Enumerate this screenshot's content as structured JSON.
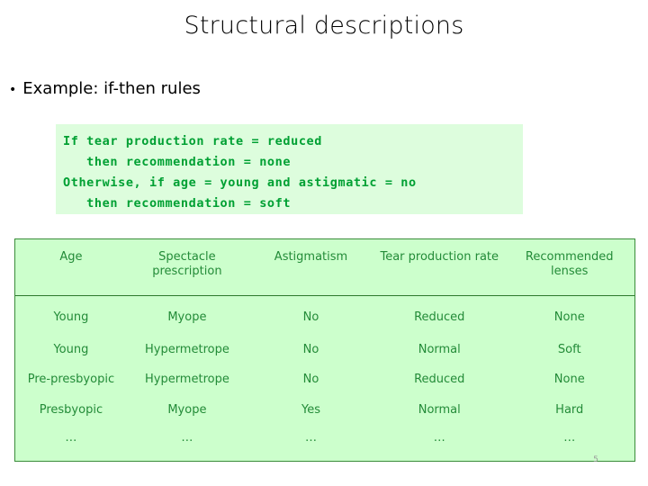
{
  "slide": {
    "title": "Structural descriptions",
    "page_number": "5",
    "bullet": {
      "marker": "•",
      "text": "Example: if-then rules"
    },
    "code_block": {
      "background_color": "#ddfddd",
      "text_color": "#00a033",
      "lines": [
        "If tear production rate = reduced",
        "   then recommendation = none",
        "Otherwise, if age = young and astigmatic = no",
        "   then recommendation = soft"
      ]
    },
    "table": {
      "border_color": "#3a8c3a",
      "background_color": "#ccffcc",
      "text_color": "#238b38",
      "headers": [
        "Age",
        "Spectacle prescription",
        "Astigmatism",
        "Tear production rate",
        "Recommended lenses"
      ],
      "rows": [
        [
          "Young",
          "Myope",
          "No",
          "Reduced",
          "None"
        ],
        [
          "Young",
          "Hypermetrope",
          "No",
          "Normal",
          "Soft"
        ],
        [
          "Pre-presbyopic",
          "Hypermetrope",
          "No",
          "Reduced",
          "None"
        ],
        [
          "Presbyopic",
          "Myope",
          "Yes",
          "Normal",
          "Hard"
        ],
        [
          "…",
          "…",
          "…",
          "…",
          "…"
        ]
      ]
    }
  }
}
